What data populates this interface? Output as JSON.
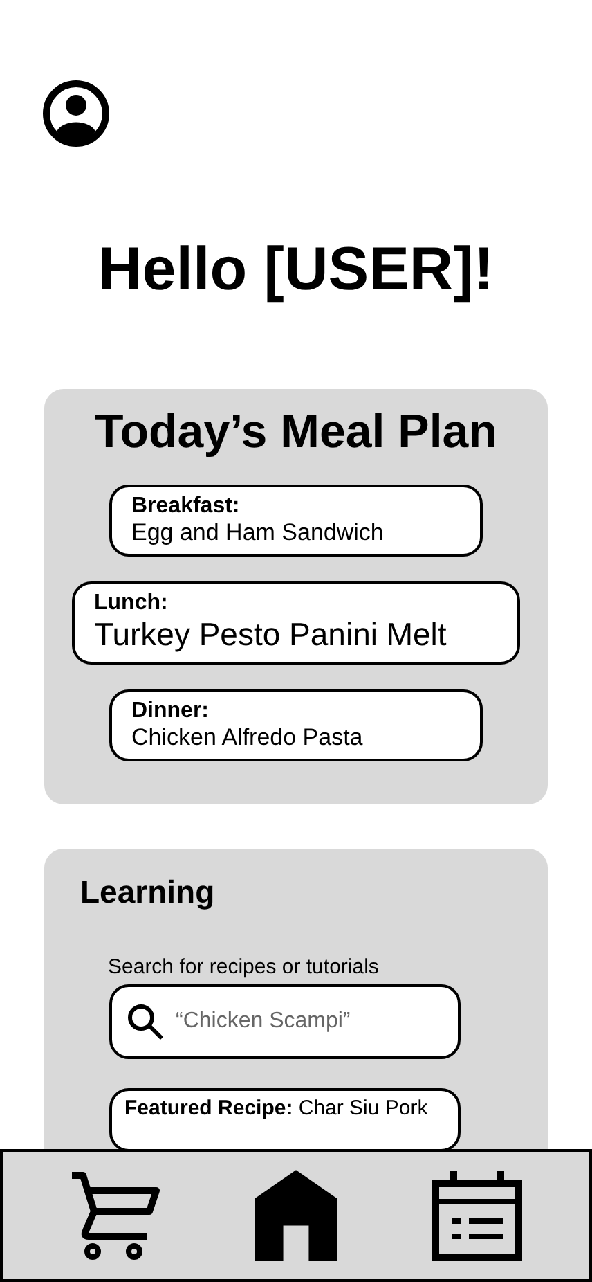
{
  "greeting": "Hello [USER]!",
  "meal_plan": {
    "title": "Today’s Meal Plan",
    "meals": [
      {
        "label": "Breakfast:",
        "dish": "Egg and Ham Sandwich",
        "selected": false
      },
      {
        "label": "Lunch:",
        "dish": "Turkey Pesto Panini Melt",
        "selected": true
      },
      {
        "label": "Dinner:",
        "dish": "Chicken Alfredo Pasta",
        "selected": false
      }
    ]
  },
  "learning": {
    "title": "Learning",
    "search_label": "Search for recipes or tutorials",
    "search": {
      "placeholder": "“Chicken Scampi”"
    },
    "featured": "**Featured Recipe:** Char Siu Pork"
  },
  "nav": [
    {
      "kind": "cart",
      "selected": false
    },
    {
      "kind": "home",
      "selected": true
    },
    {
      "kind": "calendar",
      "selected": false
    }
  ]
}
